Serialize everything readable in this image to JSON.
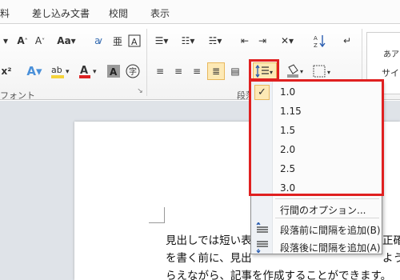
{
  "tabs": [
    "料",
    "差し込み文書",
    "校閲",
    "表示"
  ],
  "ribbon": {
    "font_group_label": "フォント",
    "paragraph_group_label": "段落",
    "style_preview_top": "あア",
    "style_preview_bottom": "サイド"
  },
  "line_spacing_menu": {
    "options": [
      "1.0",
      "1.15",
      "1.5",
      "2.0",
      "2.5",
      "3.0"
    ],
    "selected": "1.0",
    "line_options_label": "行間のオプション...",
    "add_space_before": "段落前に間隔を追加(B)",
    "add_space_after": "段落後に間隔を追加(A)"
  },
  "document": {
    "lines": [
      "見出しでは短い表",
      "を書く前に、見出",
      "らえながら、記事を作成することができます。"
    ],
    "right_fragments": [
      "正確",
      "よう"
    ]
  },
  "colors": {
    "highlight": "#f5d33b",
    "red_outline": "#e02020",
    "selected_fill": "#fde9b5"
  }
}
